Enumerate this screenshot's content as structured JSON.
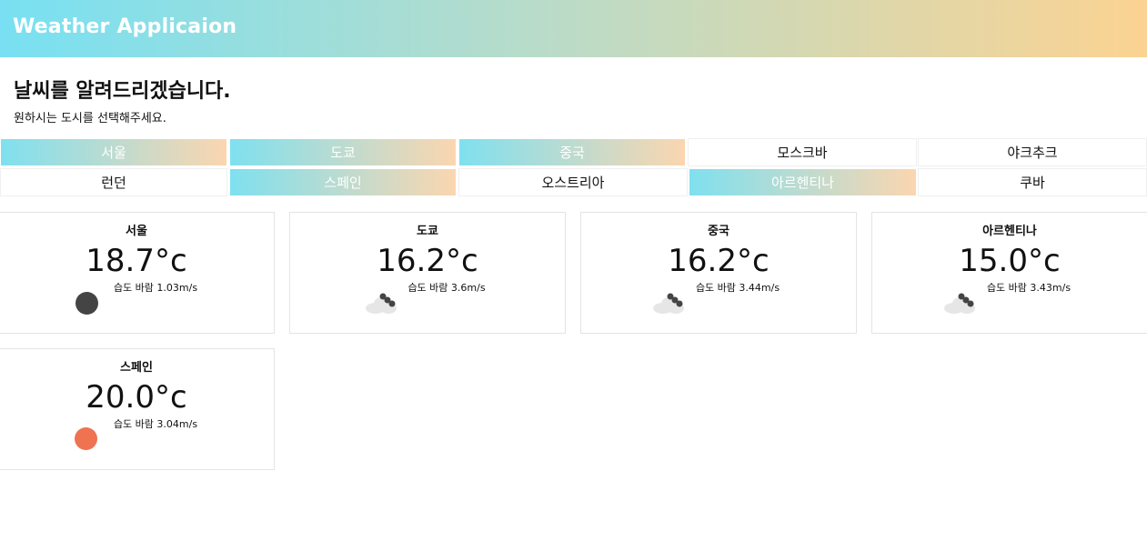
{
  "header": {
    "title": "Weather Applicaion"
  },
  "intro": {
    "title": "날씨를 알려드리겠습니다.",
    "subtitle": "원하시는 도시를 선택해주세요."
  },
  "cities": [
    {
      "label": "서울",
      "active": true
    },
    {
      "label": "도쿄",
      "active": true
    },
    {
      "label": "중국",
      "active": true
    },
    {
      "label": "모스크바",
      "active": false
    },
    {
      "label": "야크추크",
      "active": false
    },
    {
      "label": "런던",
      "active": false
    },
    {
      "label": "스페인",
      "active": true
    },
    {
      "label": "오스트리아",
      "active": false
    },
    {
      "label": "아르헨티나",
      "active": true
    },
    {
      "label": "쿠바",
      "active": false
    }
  ],
  "cards": [
    {
      "city": "서울",
      "temp": "18.7°c",
      "info": "습도 바람 1.03m/s",
      "icon": "dark-circle-icon",
      "icon_color": "#444444"
    },
    {
      "city": "도쿄",
      "temp": "16.2°c",
      "info": "습도 바람 3.6m/s",
      "icon": "cloud-icon",
      "icon_color": "#e2e2e2"
    },
    {
      "city": "중국",
      "temp": "16.2°c",
      "info": "습도 바람 3.44m/s",
      "icon": "cloud-icon",
      "icon_color": "#e2e2e2"
    },
    {
      "city": "아르헨티나",
      "temp": "15.0°c",
      "info": "습도 바람 3.43m/s",
      "icon": "cloud-icon",
      "icon_color": "#e2e2e2"
    },
    {
      "city": "스페인",
      "temp": "20.0°c",
      "info": "습도 바람 3.04m/s",
      "icon": "sun-circle-icon",
      "icon_color": "#ef7350"
    }
  ]
}
